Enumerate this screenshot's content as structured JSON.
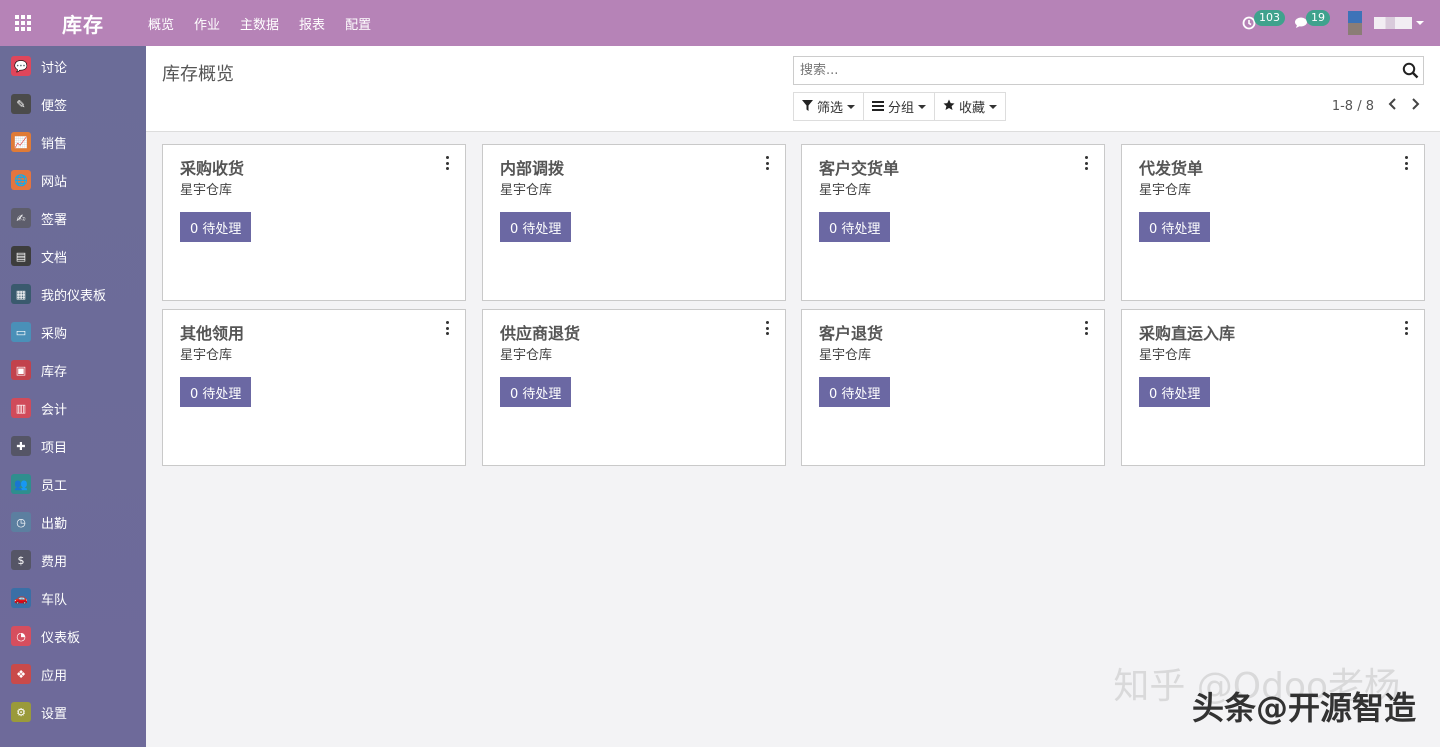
{
  "app": {
    "brand": "库存"
  },
  "topmenu": [
    "概览",
    "作业",
    "主数据",
    "报表",
    "配置"
  ],
  "systray": {
    "activity_count": "103",
    "message_count": "19"
  },
  "colors": {
    "topbar": "#b683b7",
    "sidebar": "#6b6c98",
    "primary_button": "#6b68a3",
    "badge": "#3fa28d"
  },
  "sidebar": [
    {
      "label": "讨论",
      "icon": "chat-icon",
      "color": "#e0465b",
      "glyph": "💬"
    },
    {
      "label": "便签",
      "icon": "note-icon",
      "color": "#4b4b4b",
      "glyph": "✎"
    },
    {
      "label": "销售",
      "icon": "sales-chart-icon",
      "color": "#e07b36",
      "glyph": "📈"
    },
    {
      "label": "网站",
      "icon": "globe-icon",
      "color": "#e5753e",
      "glyph": "🌐"
    },
    {
      "label": "签署",
      "icon": "sign-icon",
      "color": "#5d5d6b",
      "glyph": "✍"
    },
    {
      "label": "文档",
      "icon": "document-icon",
      "color": "#3d3d3d",
      "glyph": "▤"
    },
    {
      "label": "我的仪表板",
      "icon": "dashboard-icon",
      "color": "#3a5a6e",
      "glyph": "▦"
    },
    {
      "label": "采购",
      "icon": "purchase-card-icon",
      "color": "#4a90b8",
      "glyph": "▭"
    },
    {
      "label": "库存",
      "icon": "inventory-box-icon",
      "color": "#c2424c",
      "glyph": "▣"
    },
    {
      "label": "会计",
      "icon": "accounting-icon",
      "color": "#d04b5a",
      "glyph": "▥"
    },
    {
      "label": "项目",
      "icon": "puzzle-icon",
      "color": "#555566",
      "glyph": "✚"
    },
    {
      "label": "员工",
      "icon": "employees-icon",
      "color": "#2f8e8e",
      "glyph": "👥"
    },
    {
      "label": "出勤",
      "icon": "attendance-icon",
      "color": "#5c7fa0",
      "glyph": "◷"
    },
    {
      "label": "费用",
      "icon": "expense-icon",
      "color": "#555566",
      "glyph": "$"
    },
    {
      "label": "车队",
      "icon": "car-icon",
      "color": "#3a6fa6",
      "glyph": "🚗"
    },
    {
      "label": "仪表板",
      "icon": "gauge-icon",
      "color": "#d64e5e",
      "glyph": "◔"
    },
    {
      "label": "应用",
      "icon": "apps-cubes-icon",
      "color": "#c94a4a",
      "glyph": "❖"
    },
    {
      "label": "设置",
      "icon": "gear-icon",
      "color": "#9a9a3a",
      "glyph": "⚙"
    }
  ],
  "control": {
    "title": "库存概览",
    "search_placeholder": "搜索...",
    "filter_label": "筛选",
    "group_label": "分组",
    "favorite_label": "收藏",
    "pager": "1-8 / 8"
  },
  "cards": [
    {
      "title": "采购收货",
      "warehouse": "星宇仓库",
      "button": "0 待处理"
    },
    {
      "title": "内部调拨",
      "warehouse": "星宇仓库",
      "button": "0 待处理"
    },
    {
      "title": "客户交货单",
      "warehouse": "星宇仓库",
      "button": "0 待处理"
    },
    {
      "title": "代发货单",
      "warehouse": "星宇仓库",
      "button": "0 待处理"
    },
    {
      "title": "其他领用",
      "warehouse": "星宇仓库",
      "button": "0 待处理"
    },
    {
      "title": "供应商退货",
      "warehouse": "星宇仓库",
      "button": "0 待处理"
    },
    {
      "title": "客户退货",
      "warehouse": "星宇仓库",
      "button": "0 待处理"
    },
    {
      "title": "采购直运入库",
      "warehouse": "星宇仓库",
      "button": "0 待处理"
    }
  ],
  "watermark": {
    "line1": "知乎 @Odoo老杨",
    "line2": "头条@开源智造"
  }
}
